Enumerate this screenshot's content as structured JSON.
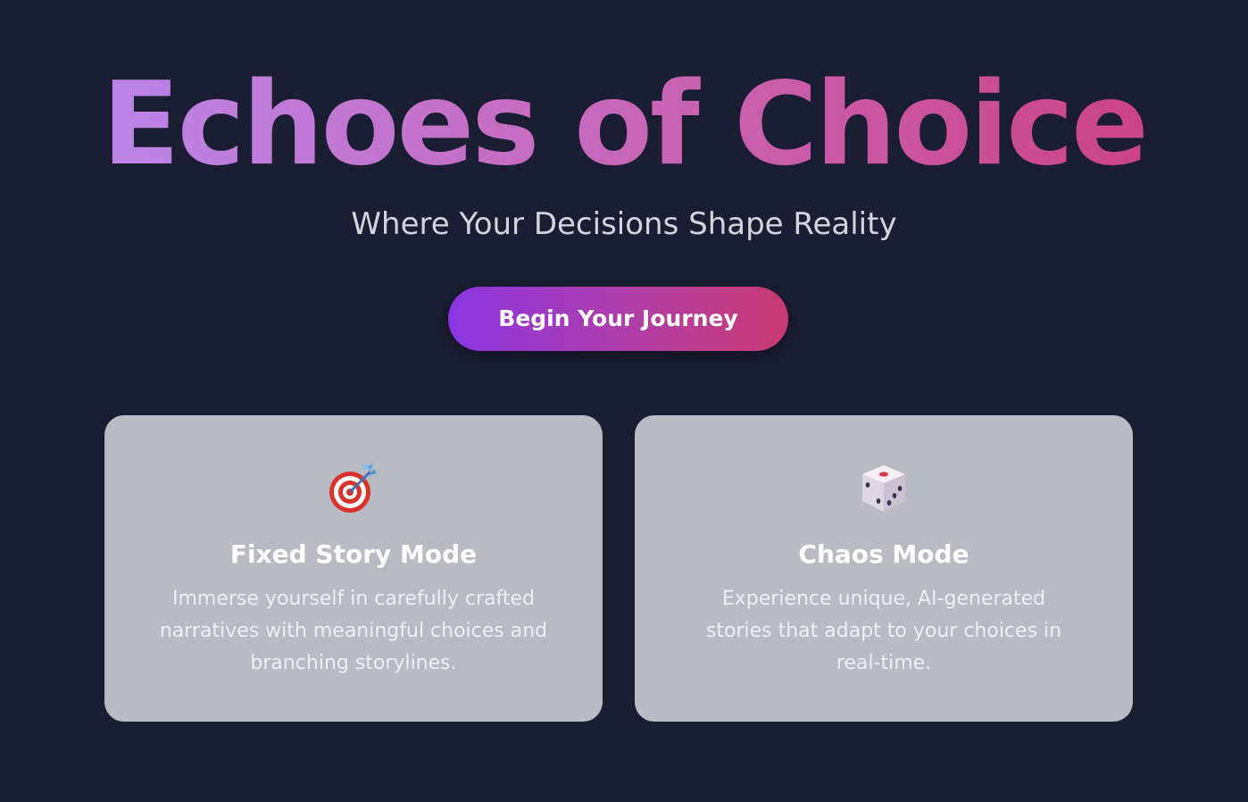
{
  "hero": {
    "title": "Echoes of Choice",
    "subtitle": "Where Your Decisions Shape Reality",
    "cta_label": "Begin Your Journey"
  },
  "modes": [
    {
      "icon": "target-dart-icon",
      "title": "Fixed Story Mode",
      "description": "Immerse yourself in carefully crafted narratives with meaningful choices and branching storylines."
    },
    {
      "icon": "dice-icon",
      "title": "Chaos Mode",
      "description": "Experience unique, AI-generated stories that adapt to your choices in real-time."
    }
  ],
  "colors": {
    "background": "#1b1e33",
    "title_gradient_start": "#b98af2",
    "title_gradient_end": "#cc3d7e",
    "button_gradient_start": "#8a35e3",
    "button_gradient_end": "#ca3a71",
    "card_background": "#b9bbc2"
  }
}
